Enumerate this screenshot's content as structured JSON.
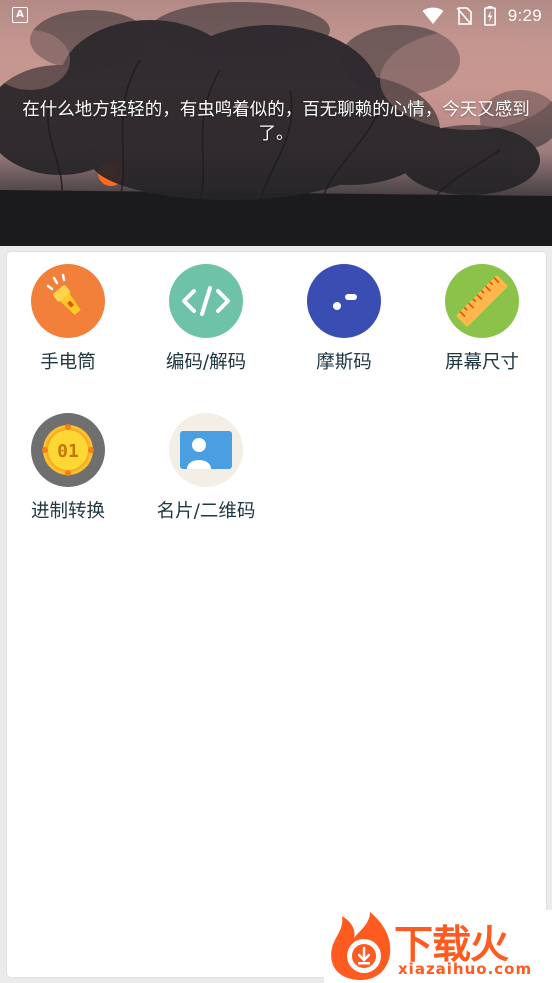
{
  "status_bar": {
    "app_badge": "A",
    "time": "9:29"
  },
  "header": {
    "quote": "在什么地方轻轻的，有虫鸣着似的，百无聊赖的心情，今天又感到了。"
  },
  "tools": [
    {
      "label": "手电筒",
      "icon": "flashlight-icon",
      "color": "#f2803a"
    },
    {
      "label": "编码/解码",
      "icon": "code-icon",
      "color": "#6ec2a7"
    },
    {
      "label": "摩斯码",
      "icon": "morse-icon",
      "color": "#3a4db3"
    },
    {
      "label": "屏幕尺寸",
      "icon": "ruler-icon",
      "color": "#8bc34a"
    },
    {
      "label": "进制转换",
      "icon": "binary-badge-icon",
      "color": "#6f6f6f"
    },
    {
      "label": "名片/二维码",
      "icon": "business-card-icon",
      "color": "#f3efe6"
    }
  ],
  "watermark": {
    "brand": "下载火",
    "domain": "xiazaihuo.com"
  }
}
